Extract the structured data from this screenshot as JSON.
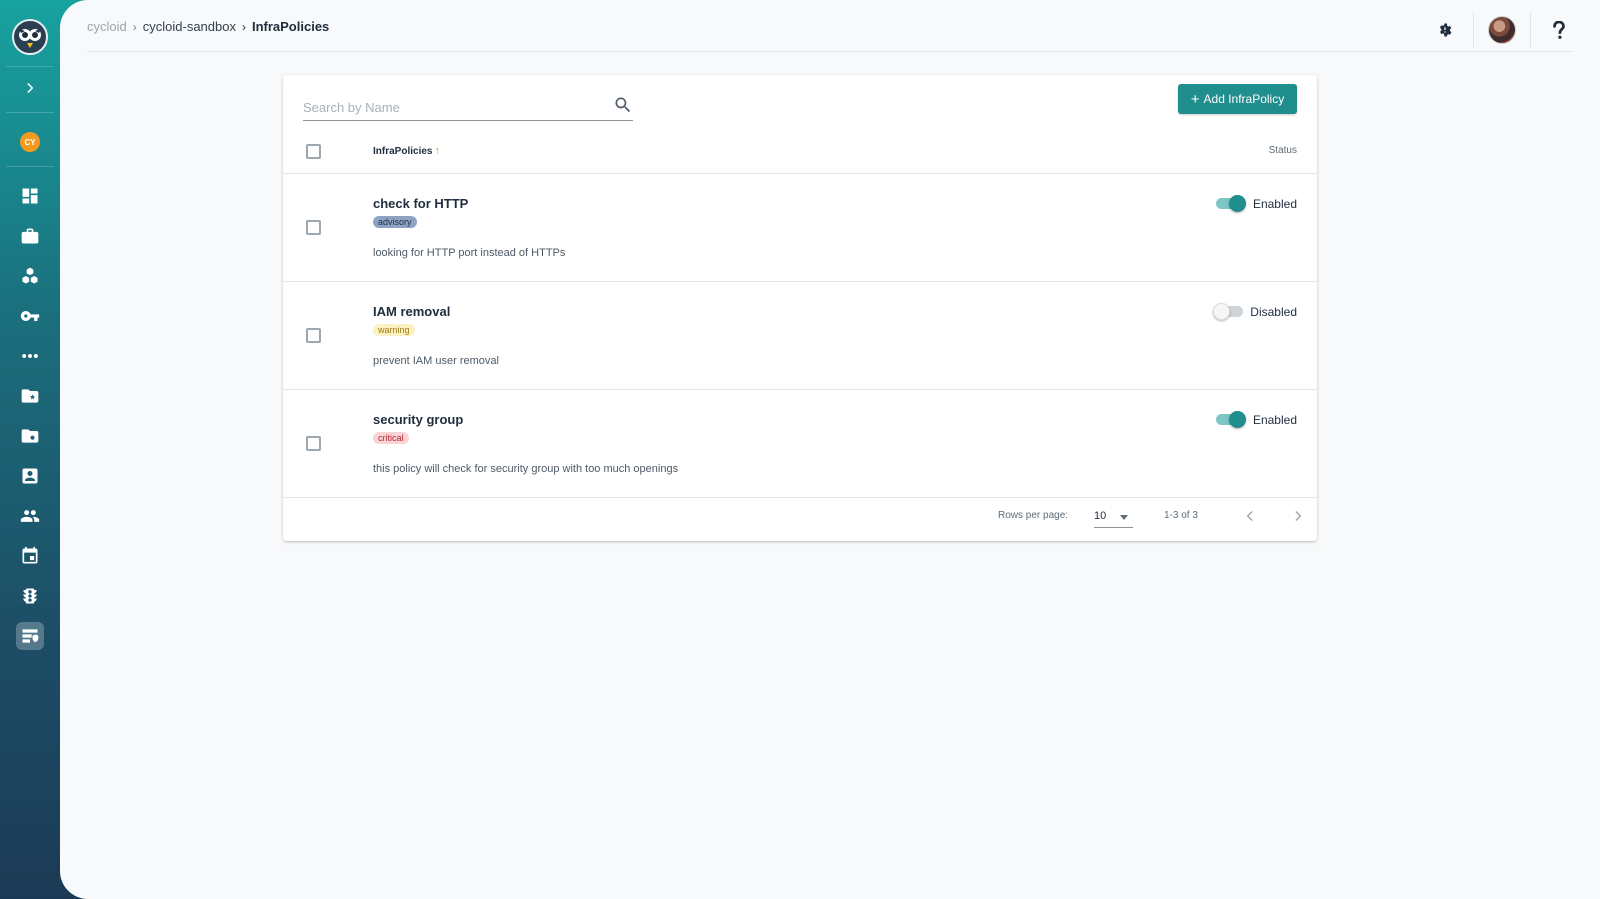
{
  "breadcrumb": {
    "root": "cycloid",
    "project": "cycloid-sandbox",
    "current": "InfraPolicies"
  },
  "sidebar": {
    "org_initials": "CY",
    "items": [
      {
        "name": "dashboard-icon"
      },
      {
        "name": "projects-icon"
      },
      {
        "name": "stacks-icon"
      },
      {
        "name": "credentials-icon"
      },
      {
        "name": "more-icon"
      },
      {
        "name": "catalog-repositories-icon"
      },
      {
        "name": "config-repositories-icon"
      },
      {
        "name": "members-icon"
      },
      {
        "name": "teams-icon"
      },
      {
        "name": "events-icon"
      },
      {
        "name": "pipelines-icon"
      },
      {
        "name": "infrapolicies-icon",
        "active": true
      }
    ]
  },
  "search": {
    "placeholder": "Search by Name",
    "value": ""
  },
  "toolbar": {
    "add_label": "Add InfraPolicy"
  },
  "table": {
    "columns": {
      "name": "InfraPolicies",
      "status": "Status"
    },
    "rows": [
      {
        "name": "check for HTTP",
        "severity": "advisory",
        "description": "looking for HTTP port instead of HTTPs",
        "enabled": true,
        "status": "Enabled"
      },
      {
        "name": "IAM removal",
        "severity": "warning",
        "description": "prevent IAM user removal",
        "enabled": false,
        "status": "Disabled"
      },
      {
        "name": "security group",
        "severity": "critical",
        "description": "this policy will check for security group with too much openings",
        "enabled": true,
        "status": "Enabled"
      }
    ]
  },
  "pagination": {
    "rows_per_page_label": "Rows per page:",
    "rows_per_page": "10",
    "range": "1-3 of 3"
  },
  "colors": {
    "accent": "#1f8e8c",
    "advisory": "#8ea3c4",
    "warning": "#fbf1c2",
    "critical": "#fad3d6",
    "org_badge": "#f29a1f"
  }
}
